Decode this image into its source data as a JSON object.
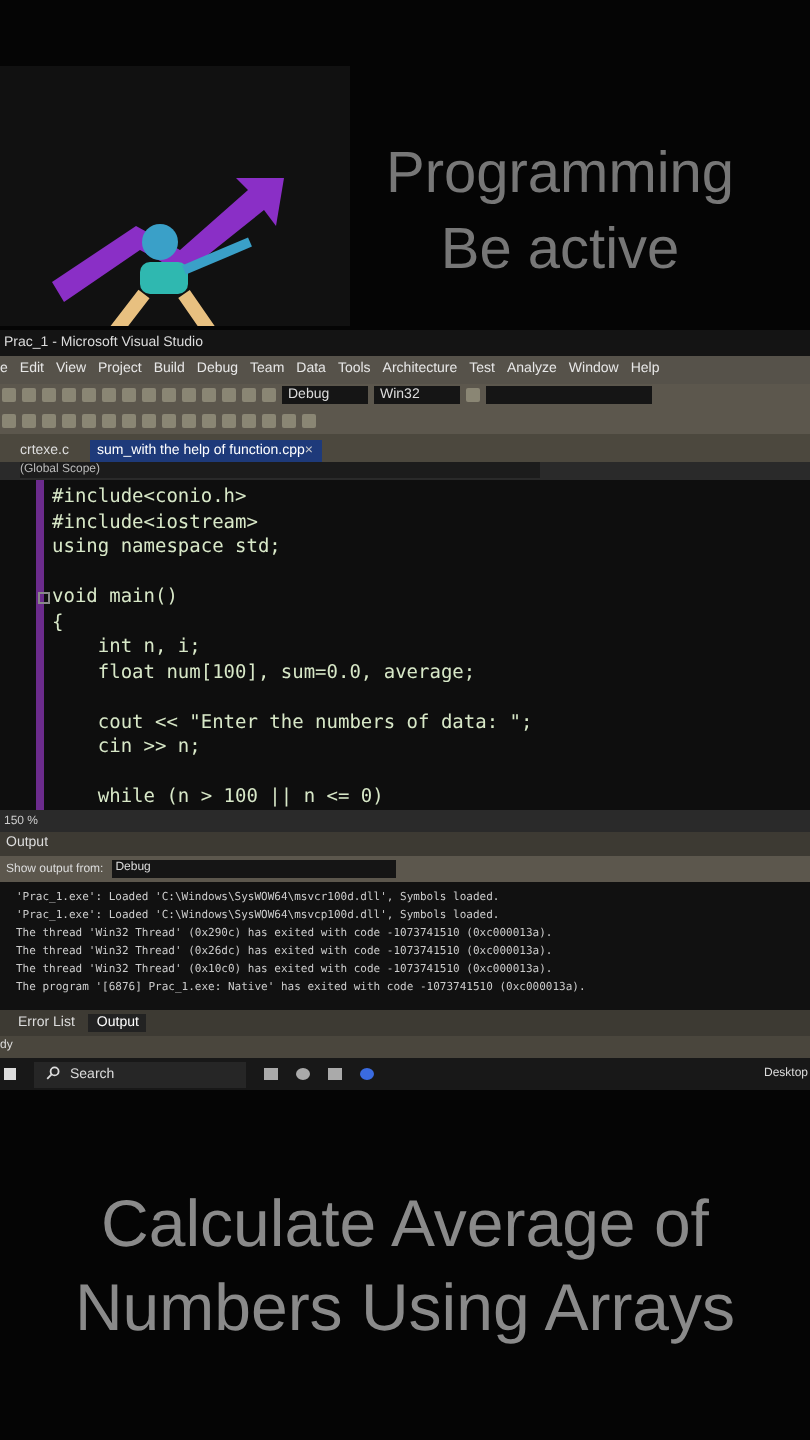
{
  "banner": {
    "titles": [
      "Programming",
      "Be active"
    ]
  },
  "window": {
    "title": "Prac_1 - Microsoft Visual Studio"
  },
  "menu": [
    "e",
    "Edit",
    "View",
    "Project",
    "Build",
    "Debug",
    "Team",
    "Data",
    "Tools",
    "Architecture",
    "Test",
    "Analyze",
    "Window",
    "Help"
  ],
  "toolbar": {
    "configuration": "Debug",
    "platform": "Win32"
  },
  "tabs": [
    {
      "label": "crtexe.c",
      "selected": false
    },
    {
      "label": "sum_with the help of function.cpp",
      "selected": true,
      "close": "×"
    }
  ],
  "scope": "(Global Scope)",
  "code": [
    {
      "kind": "code",
      "text": "#include<conio.h>"
    },
    {
      "kind": "code",
      "text": "#include<iostream>"
    },
    {
      "kind": "code",
      "text": "using namespace std;"
    },
    {
      "kind": "blank"
    },
    {
      "kind": "fold",
      "text": "void main()"
    },
    {
      "kind": "code",
      "text": "{"
    },
    {
      "kind": "code",
      "text": "    int n, i;"
    },
    {
      "kind": "code",
      "text": "    float num[100], sum=0.0, average;"
    },
    {
      "kind": "blank"
    },
    {
      "kind": "code",
      "text": "    cout << \"Enter the numbers of data: \";"
    },
    {
      "kind": "code",
      "text": "    cin >> n;"
    },
    {
      "kind": "blank"
    },
    {
      "kind": "code",
      "text": "    while (n > 100 || n <= 0)"
    }
  ],
  "zoom": "150 %",
  "output": {
    "title": "Output",
    "show_from_label": "Show output from:",
    "source": "Debug",
    "lines": [
      "'Prac_1.exe': Loaded 'C:\\Windows\\SysWOW64\\msvcr100d.dll', Symbols loaded.",
      "'Prac_1.exe': Loaded 'C:\\Windows\\SysWOW64\\msvcp100d.dll', Symbols loaded.",
      "The thread 'Win32 Thread' (0x290c) has exited with code -1073741510 (0xc000013a).",
      "The thread 'Win32 Thread' (0x26dc) has exited with code -1073741510 (0xc000013a).",
      "The thread 'Win32 Thread' (0x10c0) has exited with code -1073741510 (0xc000013a).",
      "The program '[6876] Prac_1.exe: Native' has exited with code -1073741510 (0xc000013a)."
    ]
  },
  "panel_tabs": [
    {
      "label": "Error List",
      "selected": false
    },
    {
      "label": "Output",
      "selected": true
    }
  ],
  "status": "dy",
  "taskbar": {
    "search": "Search",
    "desktop": "Desktop"
  },
  "caption": [
    "Calculate Average of",
    "Numbers Using Arrays"
  ]
}
